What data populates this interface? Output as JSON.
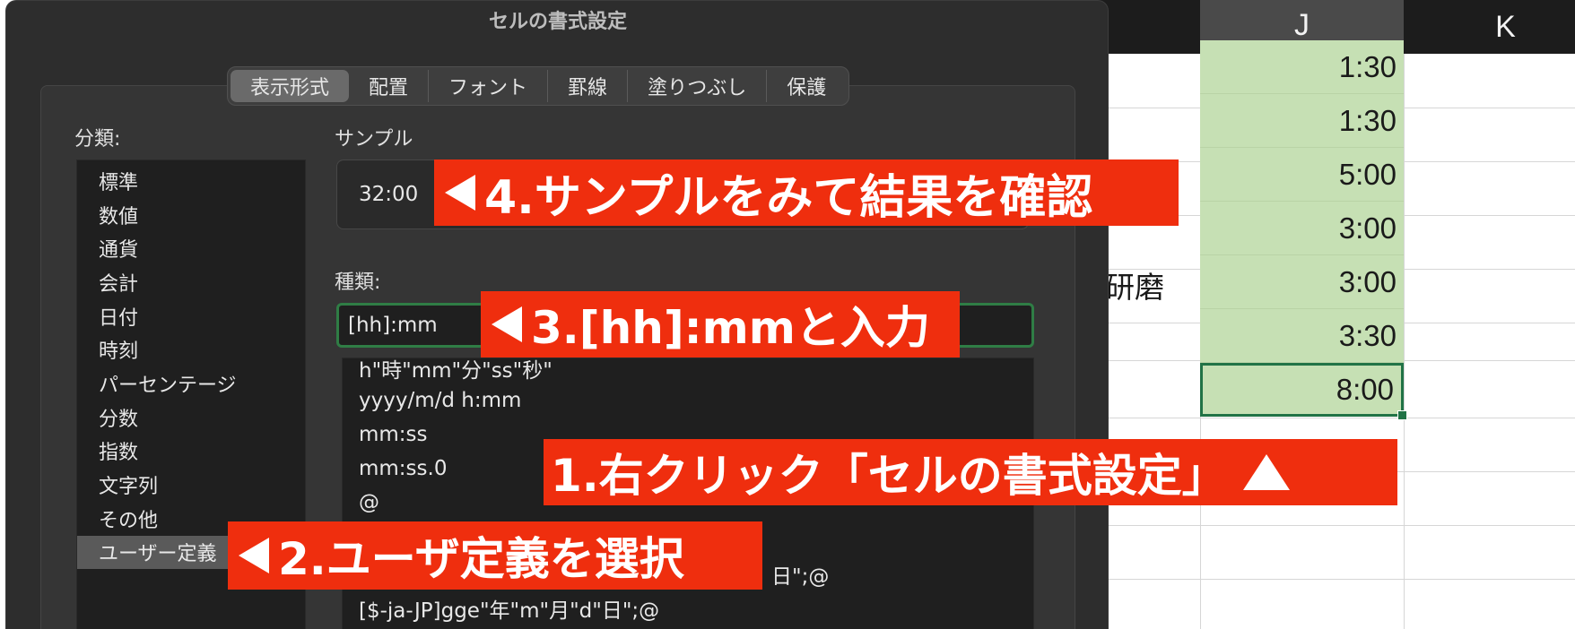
{
  "sheet": {
    "columns": [
      "J",
      "K"
    ],
    "j_values": [
      "1:30",
      "1:30",
      "5:00",
      "3:00",
      "3:00",
      "3:30",
      "8:00"
    ],
    "i_text": "研磨"
  },
  "dialog": {
    "title": "セルの書式設定",
    "tabs": [
      "表示形式",
      "配置",
      "フォント",
      "罫線",
      "塗りつぶし",
      "保護"
    ],
    "category_label": "分類:",
    "categories": [
      "標準",
      "数値",
      "通貨",
      "会計",
      "日付",
      "時刻",
      "パーセンテージ",
      "分数",
      "指数",
      "文字列",
      "その他",
      "ユーザー定義"
    ],
    "sample_label": "サンプル",
    "sample_value": "32:00",
    "type_label": "種類:",
    "type_value": "[hh]:mm",
    "formats": [
      "h\"時\"mm\"分\"ss\"秒\"",
      "yyyy/m/d h:mm",
      "mm:ss",
      "mm:ss.0",
      "@",
      "日\";@",
      "[$-ja-JP]gge\"年\"m\"月\"d\"日\";@"
    ]
  },
  "annotations": {
    "step1": "1.右クリック「セルの書式設定」",
    "step2": "2.ユーザ定義を選択",
    "step3": "3.[hh]:mmと入力",
    "step4": "4.サンプルをみて結果を確認"
  },
  "colors": {
    "annotation": "#ef2e0e",
    "selected_cell": "#c6e0b4",
    "excel_green": "#217346"
  }
}
